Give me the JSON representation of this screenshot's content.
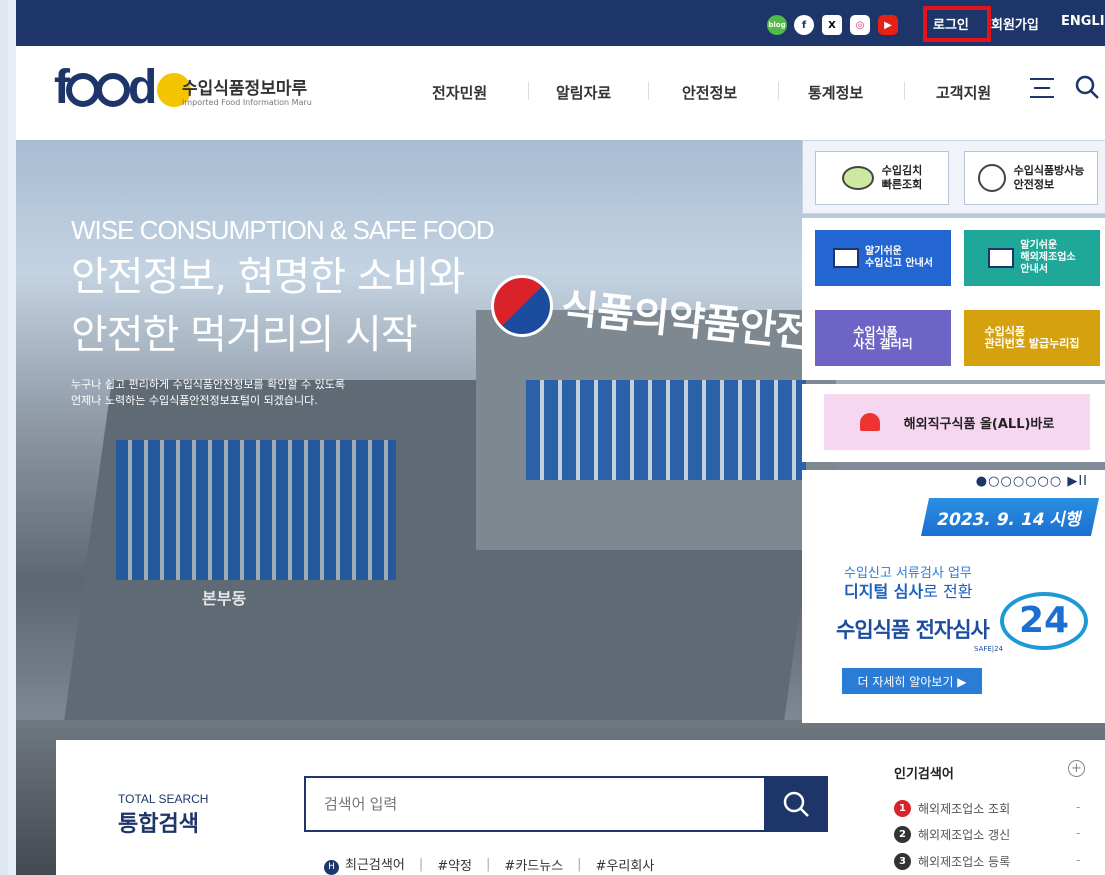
{
  "topbar": {
    "sns": [
      {
        "name": "blog-icon",
        "label": "blog"
      },
      {
        "name": "facebook-icon",
        "label": "f"
      },
      {
        "name": "x-icon",
        "label": "X"
      },
      {
        "name": "instagram-icon",
        "label": "◎"
      },
      {
        "name": "youtube-icon",
        "label": "▶"
      }
    ],
    "login": "로그인",
    "signup": "회원가입",
    "english": "ENGLISH"
  },
  "header": {
    "logo_word": "food",
    "logo_ko": "수입식품정보마루",
    "logo_en": "Imported Food Information Maru",
    "nav": [
      "전자민원",
      "알림자료",
      "안전정보",
      "통계정보",
      "고객지원"
    ]
  },
  "hero": {
    "en": "WISE CONSUMPTION & SAFE FOOD",
    "title1": "안전정보, 현명한 소비와",
    "title2": "안전한 먹거리의 시작",
    "sub1": "누구나 쉽고 편리하게 수입식품안전정보를 확인할 수 있도록",
    "sub2": "언제나 노력하는 수입식품안전정보포털이 되겠습니다.",
    "sign": "식품의약품안전처",
    "building": "본부동"
  },
  "quick": {
    "kimchi": "수입김치\n빠른조회",
    "radiation": "수입식품방사능\n안전정보",
    "guide1": "알기쉬운\n수입신고 안내서",
    "guide2": "알기쉬운\n해외제조업소\n안내서",
    "gallery": "수입식품\n사진 갤러리",
    "number": "수입식품\n관리번호 발급누리집",
    "direct": "해외직구식품 올(ALL)바로"
  },
  "slide": {
    "dots": "●○○○○○○ ▶II",
    "date": "2023. 9. 14 시행",
    "line1": "수입신고 서류검사 업무",
    "line2_bold": "디지털 심사",
    "line2_rest": "로 전환",
    "big": "수입식품 전자심사",
    "num": "24",
    "safe": "SAFE|24",
    "button": "더 자세히 알아보기 ▶"
  },
  "search": {
    "en": "TOTAL SEARCH",
    "ko": "통합검색",
    "placeholder": "검색어 입력",
    "recent_label": "최근검색어",
    "tags": [
      "#약정",
      "#카드뉴스",
      "#우리회사"
    ],
    "popular_title": "인기검색어",
    "popular": [
      {
        "rank": "1",
        "text": "해외제조업소 조회"
      },
      {
        "rank": "2",
        "text": "해외제조업소 갱신"
      },
      {
        "rank": "3",
        "text": "해외제조업소 등록"
      }
    ]
  },
  "colors": {
    "brand": "#1e3569",
    "login_highlight": "#e3121b",
    "accent": "#2a7cd6"
  }
}
